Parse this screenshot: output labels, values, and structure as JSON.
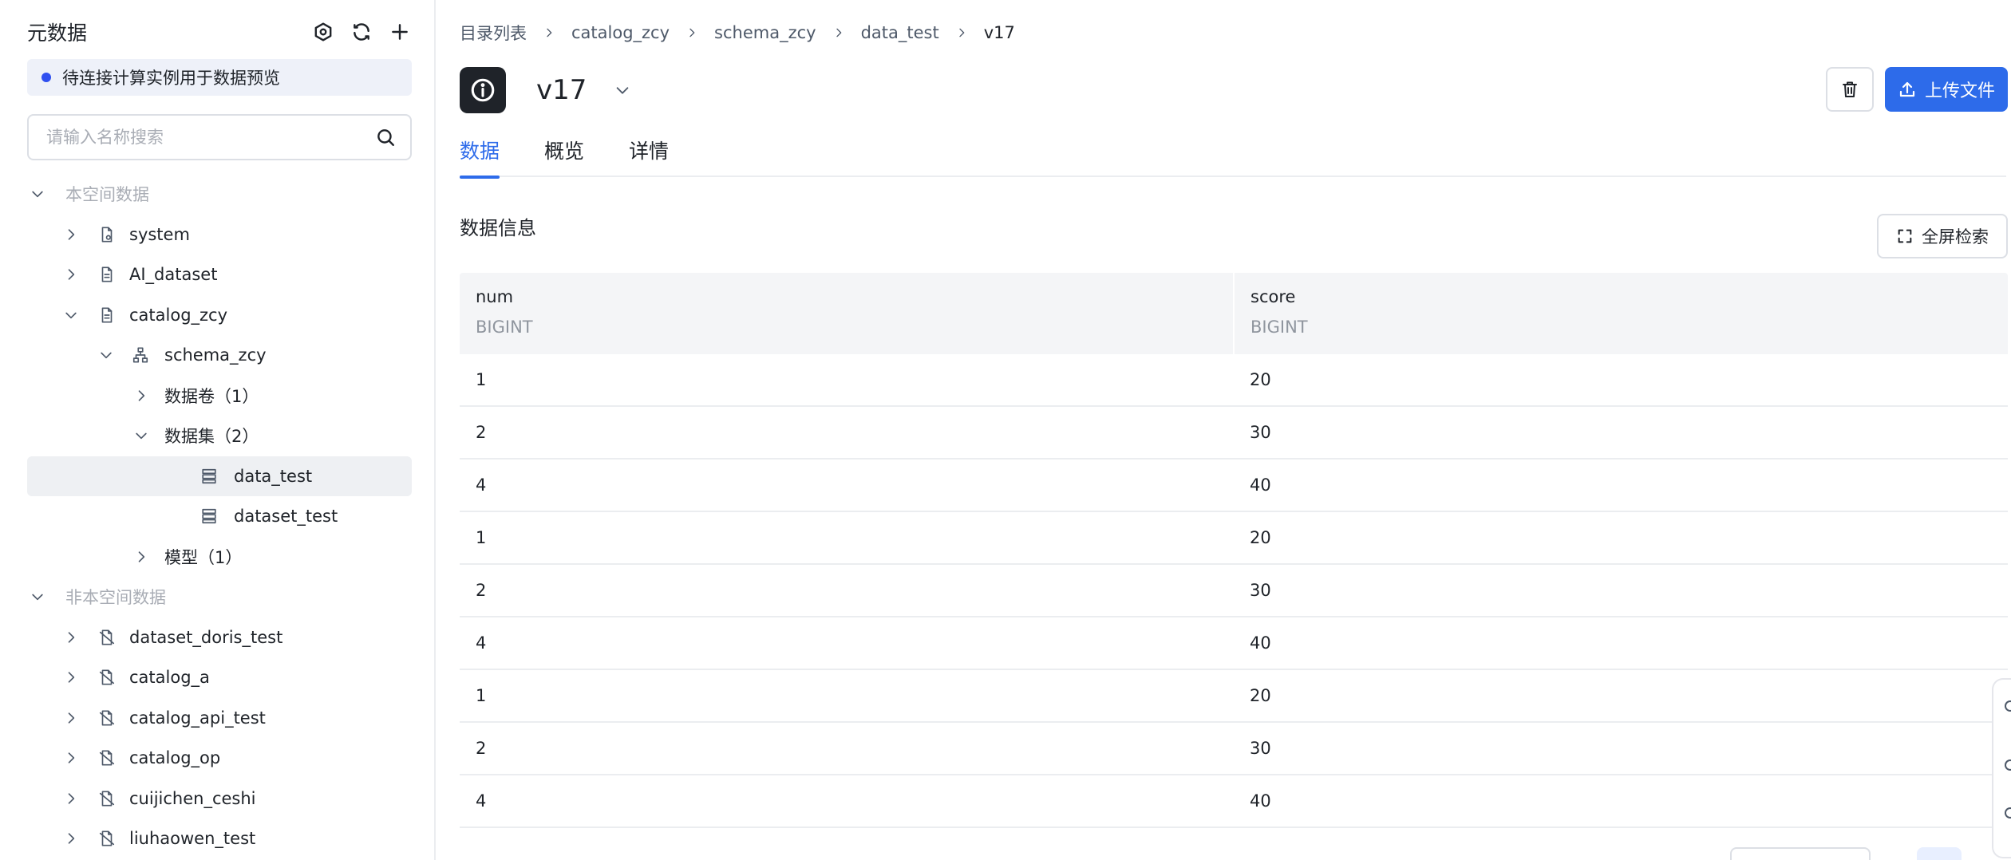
{
  "sidebar": {
    "title": "元数据",
    "notice": "待连接计算实例用于数据预览",
    "search_placeholder": "请输入名称搜索",
    "tree": [
      {
        "label": "本空间数据",
        "type": "group",
        "expanded": true,
        "icon": "none"
      },
      {
        "label": "system",
        "type": "catalog",
        "icon": "catalog-settings-icon"
      },
      {
        "label": "AI_dataset",
        "type": "catalog",
        "icon": "catalog-icon"
      },
      {
        "label": "catalog_zcy",
        "type": "catalog",
        "expanded": true,
        "icon": "catalog-icon"
      },
      {
        "label": "schema_zcy",
        "type": "schema",
        "expanded": true,
        "icon": "schema-icon"
      },
      {
        "label": "数据卷（1）",
        "type": "folder"
      },
      {
        "label": "数据集（2）",
        "type": "folder",
        "expanded": true
      },
      {
        "label": "data_test",
        "type": "dataset",
        "selected": true,
        "icon": "dataset-icon"
      },
      {
        "label": "dataset_test",
        "type": "dataset",
        "icon": "dataset-icon"
      },
      {
        "label": "模型（1）",
        "type": "folder"
      },
      {
        "label": "非本空间数据",
        "type": "group",
        "expanded": true
      },
      {
        "label": "dataset_doris_test",
        "type": "catalog",
        "icon": "catalog-off-icon"
      },
      {
        "label": "catalog_a",
        "type": "catalog",
        "icon": "catalog-off-icon"
      },
      {
        "label": "catalog_api_test",
        "type": "catalog",
        "icon": "catalog-off-icon"
      },
      {
        "label": "catalog_op",
        "type": "catalog",
        "icon": "catalog-off-icon"
      },
      {
        "label": "cuijichen_ceshi",
        "type": "catalog",
        "icon": "catalog-off-icon"
      },
      {
        "label": "liuhaowen_test",
        "type": "catalog",
        "icon": "catalog-off-icon"
      }
    ]
  },
  "breadcrumb": [
    "目录列表",
    "catalog_zcy",
    "schema_zcy",
    "data_test",
    "v17"
  ],
  "header": {
    "title": "v17",
    "upload_label": "上传文件"
  },
  "tabs": [
    {
      "label": "数据",
      "active": true
    },
    {
      "label": "概览",
      "active": false
    },
    {
      "label": "详情",
      "active": false
    }
  ],
  "section": {
    "title": "数据信息",
    "fullscreen_label": "全屏检索"
  },
  "table": {
    "columns": [
      {
        "name": "num",
        "type": "BIGINT"
      },
      {
        "name": "score",
        "type": "BIGINT"
      }
    ],
    "rows": [
      [
        "1",
        "20"
      ],
      [
        "2",
        "30"
      ],
      [
        "4",
        "40"
      ],
      [
        "1",
        "20"
      ],
      [
        "2",
        "30"
      ],
      [
        "4",
        "40"
      ],
      [
        "1",
        "20"
      ],
      [
        "2",
        "30"
      ],
      [
        "4",
        "40"
      ]
    ]
  },
  "colors": {
    "accent": "#2d6bea",
    "notice_dot": "#3050f0",
    "selected_row": "#eef0f3"
  }
}
